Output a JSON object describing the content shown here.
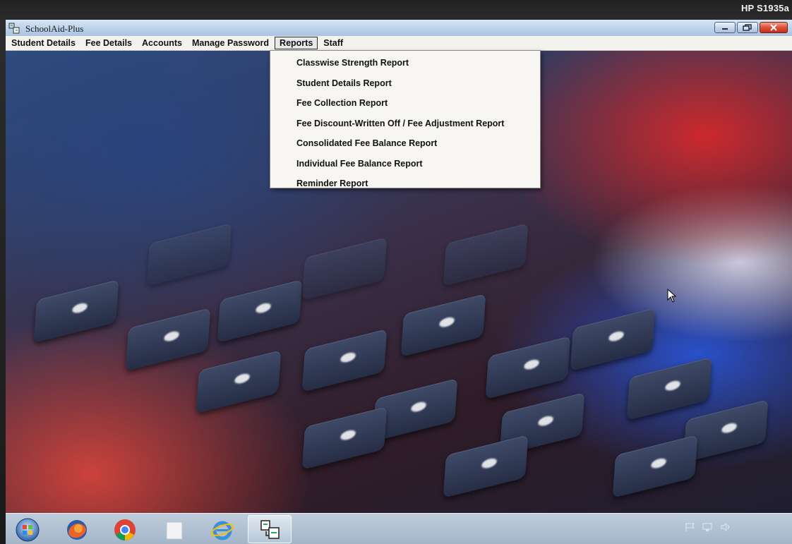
{
  "monitor": {
    "label": "HP S1935a"
  },
  "window": {
    "title": "SchoolAid-Plus",
    "controls": [
      "minimize",
      "restore",
      "close"
    ]
  },
  "menu": {
    "items": [
      {
        "label": "Student Details"
      },
      {
        "label": "Fee Details"
      },
      {
        "label": "Accounts"
      },
      {
        "label": "Manage Password"
      },
      {
        "label": "Reports",
        "active": true
      },
      {
        "label": "Staff"
      }
    ]
  },
  "reports_menu": {
    "items": [
      {
        "label": "Classwise Strength Report"
      },
      {
        "label": "Student Details Report"
      },
      {
        "label": "Fee Collection Report"
      },
      {
        "label": "Fee Discount-Written Off / Fee Adjustment Report"
      },
      {
        "label": "Consolidated Fee Balance Report"
      },
      {
        "label": "Individual Fee Balance Report"
      },
      {
        "label": "Reminder Report"
      }
    ]
  },
  "taskbar": {
    "icons": [
      "windows-start-icon",
      "firefox-icon",
      "chrome-icon",
      "file-explorer-icon",
      "internet-explorer-icon",
      "schoolaid-app-icon"
    ],
    "tray_icons": [
      "flag-icon",
      "network-icon",
      "volume-icon"
    ]
  },
  "colors": {
    "titlebar": "#bcd2ea",
    "menubar": "#f4f2ee",
    "dropdown": "#f7f6f2",
    "close_button": "#d9513a"
  }
}
